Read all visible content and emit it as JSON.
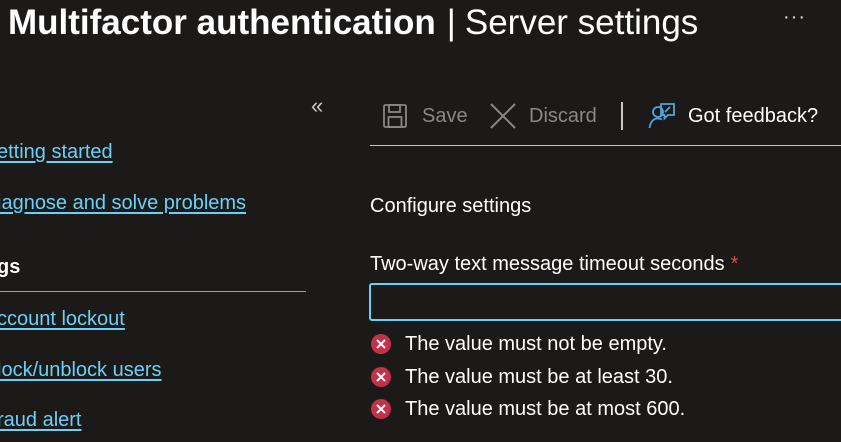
{
  "header": {
    "title_bold": "Multifactor authentication",
    "separator": "|",
    "title_rest": "Server settings",
    "more_label": "···"
  },
  "sidebar": {
    "collapse_label": "«",
    "items": [
      {
        "label": "etting started"
      },
      {
        "label": "iagnose and solve problems"
      }
    ],
    "section": "gs",
    "section_items": [
      {
        "label": "ccount lockout"
      },
      {
        "label": "lock/unblock users"
      },
      {
        "label": "raud alert"
      }
    ]
  },
  "toolbar": {
    "save_label": "Save",
    "discard_label": "Discard",
    "feedback_label": "Got feedback?"
  },
  "form": {
    "section_title": "Configure settings",
    "field_label": "Two-way text message timeout seconds",
    "required_marker": "*",
    "field_value": "",
    "errors": [
      "The value must not be empty.",
      "The value must be at least 30.",
      "The value must be at most 600."
    ]
  },
  "colors": {
    "link": "#6ccff6",
    "error": "#c4314b",
    "required": "#e04a4a",
    "background": "#1b1a19"
  }
}
